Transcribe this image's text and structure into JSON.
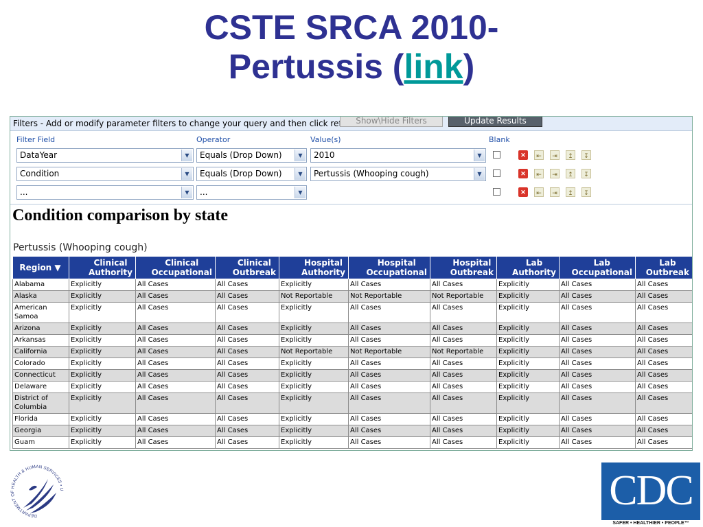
{
  "slide": {
    "title_line1": "CSTE SRCA 2010-",
    "title_line2_prefix": "Pertussis (",
    "title_link": "link",
    "title_line2_suffix": ")"
  },
  "filters": {
    "instructions": "Filters - Add or modify parameter filters to change your query and then click refresh",
    "show_hide_label": "Show\\Hide Filters",
    "update_label": "Update Results",
    "labels": {
      "field": "Filter Field",
      "operator": "Operator",
      "value": "Value(s)",
      "blank": "Blank"
    },
    "rows": [
      {
        "field": "DataYear",
        "operator": "Equals (Drop Down)",
        "value": "2010",
        "blank": false
      },
      {
        "field": "Condition",
        "operator": "Equals (Drop Down)",
        "value": "Pertussis (Whooping cough)",
        "blank": false
      },
      {
        "field": "...",
        "operator": "...",
        "value": "",
        "blank": false
      }
    ]
  },
  "report": {
    "title": "Condition comparison by state",
    "subtitle": "Pertussis (Whooping cough)",
    "columns": [
      {
        "line1": "Region ▼",
        "line2": ""
      },
      {
        "line1": "Clinical",
        "line2": "Authority"
      },
      {
        "line1": "Clinical",
        "line2": "Occupational"
      },
      {
        "line1": "Clinical",
        "line2": "Outbreak"
      },
      {
        "line1": "Hospital",
        "line2": "Authority"
      },
      {
        "line1": "Hospital",
        "line2": "Occupational"
      },
      {
        "line1": "Hospital",
        "line2": "Outbreak"
      },
      {
        "line1": "Lab",
        "line2": "Authority"
      },
      {
        "line1": "Lab",
        "line2": "Occupational"
      },
      {
        "line1": "Lab",
        "line2": "Outbreak"
      }
    ],
    "rows": [
      [
        "Alabama",
        "Explicitly",
        "All Cases",
        "All Cases",
        "Explicitly",
        "All Cases",
        "All Cases",
        "Explicitly",
        "All Cases",
        "All Cases"
      ],
      [
        "Alaska",
        "Explicitly",
        "All Cases",
        "All Cases",
        "Not Reportable",
        "Not Reportable",
        "Not Reportable",
        "Explicitly",
        "All Cases",
        "All Cases"
      ],
      [
        "American Samoa",
        "Explicitly",
        "All Cases",
        "All Cases",
        "Explicitly",
        "All Cases",
        "All Cases",
        "Explicitly",
        "All Cases",
        "All Cases"
      ],
      [
        "Arizona",
        "Explicitly",
        "All Cases",
        "All Cases",
        "Explicitly",
        "All Cases",
        "All Cases",
        "Explicitly",
        "All Cases",
        "All Cases"
      ],
      [
        "Arkansas",
        "Explicitly",
        "All Cases",
        "All Cases",
        "Explicitly",
        "All Cases",
        "All Cases",
        "Explicitly",
        "All Cases",
        "All Cases"
      ],
      [
        "California",
        "Explicitly",
        "All Cases",
        "All Cases",
        "Not Reportable",
        "Not Reportable",
        "Not Reportable",
        "Explicitly",
        "All Cases",
        "All Cases"
      ],
      [
        "Colorado",
        "Explicitly",
        "All Cases",
        "All Cases",
        "Explicitly",
        "All Cases",
        "All Cases",
        "Explicitly",
        "All Cases",
        "All Cases"
      ],
      [
        "Connecticut",
        "Explicitly",
        "All Cases",
        "All Cases",
        "Explicitly",
        "All Cases",
        "All Cases",
        "Explicitly",
        "All Cases",
        "All Cases"
      ],
      [
        "Delaware",
        "Explicitly",
        "All Cases",
        "All Cases",
        "Explicitly",
        "All Cases",
        "All Cases",
        "Explicitly",
        "All Cases",
        "All Cases"
      ],
      [
        "District of Columbia",
        "Explicitly",
        "All Cases",
        "All Cases",
        "Explicitly",
        "All Cases",
        "All Cases",
        "Explicitly",
        "All Cases",
        "All Cases"
      ],
      [
        "Florida",
        "Explicitly",
        "All Cases",
        "All Cases",
        "Explicitly",
        "All Cases",
        "All Cases",
        "Explicitly",
        "All Cases",
        "All Cases"
      ],
      [
        "Georgia",
        "Explicitly",
        "All Cases",
        "All Cases",
        "Explicitly",
        "All Cases",
        "All Cases",
        "Explicitly",
        "All Cases",
        "All Cases"
      ],
      [
        "Guam",
        "Explicitly",
        "All Cases",
        "All Cases",
        "Explicitly",
        "All Cases",
        "All Cases",
        "Explicitly",
        "All Cases",
        "All Cases"
      ]
    ]
  },
  "logos": {
    "hhs_text": "DEPARTMENT OF HEALTH & HUMAN SERVICES • USA",
    "cdc_text": "CDC",
    "cdc_tagline": "SAFER • HEALTHIER • PEOPLE™"
  },
  "colors": {
    "title": "#2e3192",
    "link": "#009999",
    "header_bg": "#1f3f99",
    "cdc_blue": "#1c5ea8",
    "row_alt": "#dcdcdc"
  },
  "icons": [
    "delete-icon",
    "move-up-icon",
    "indent-icon",
    "outdent-icon",
    "move-down-icon"
  ]
}
